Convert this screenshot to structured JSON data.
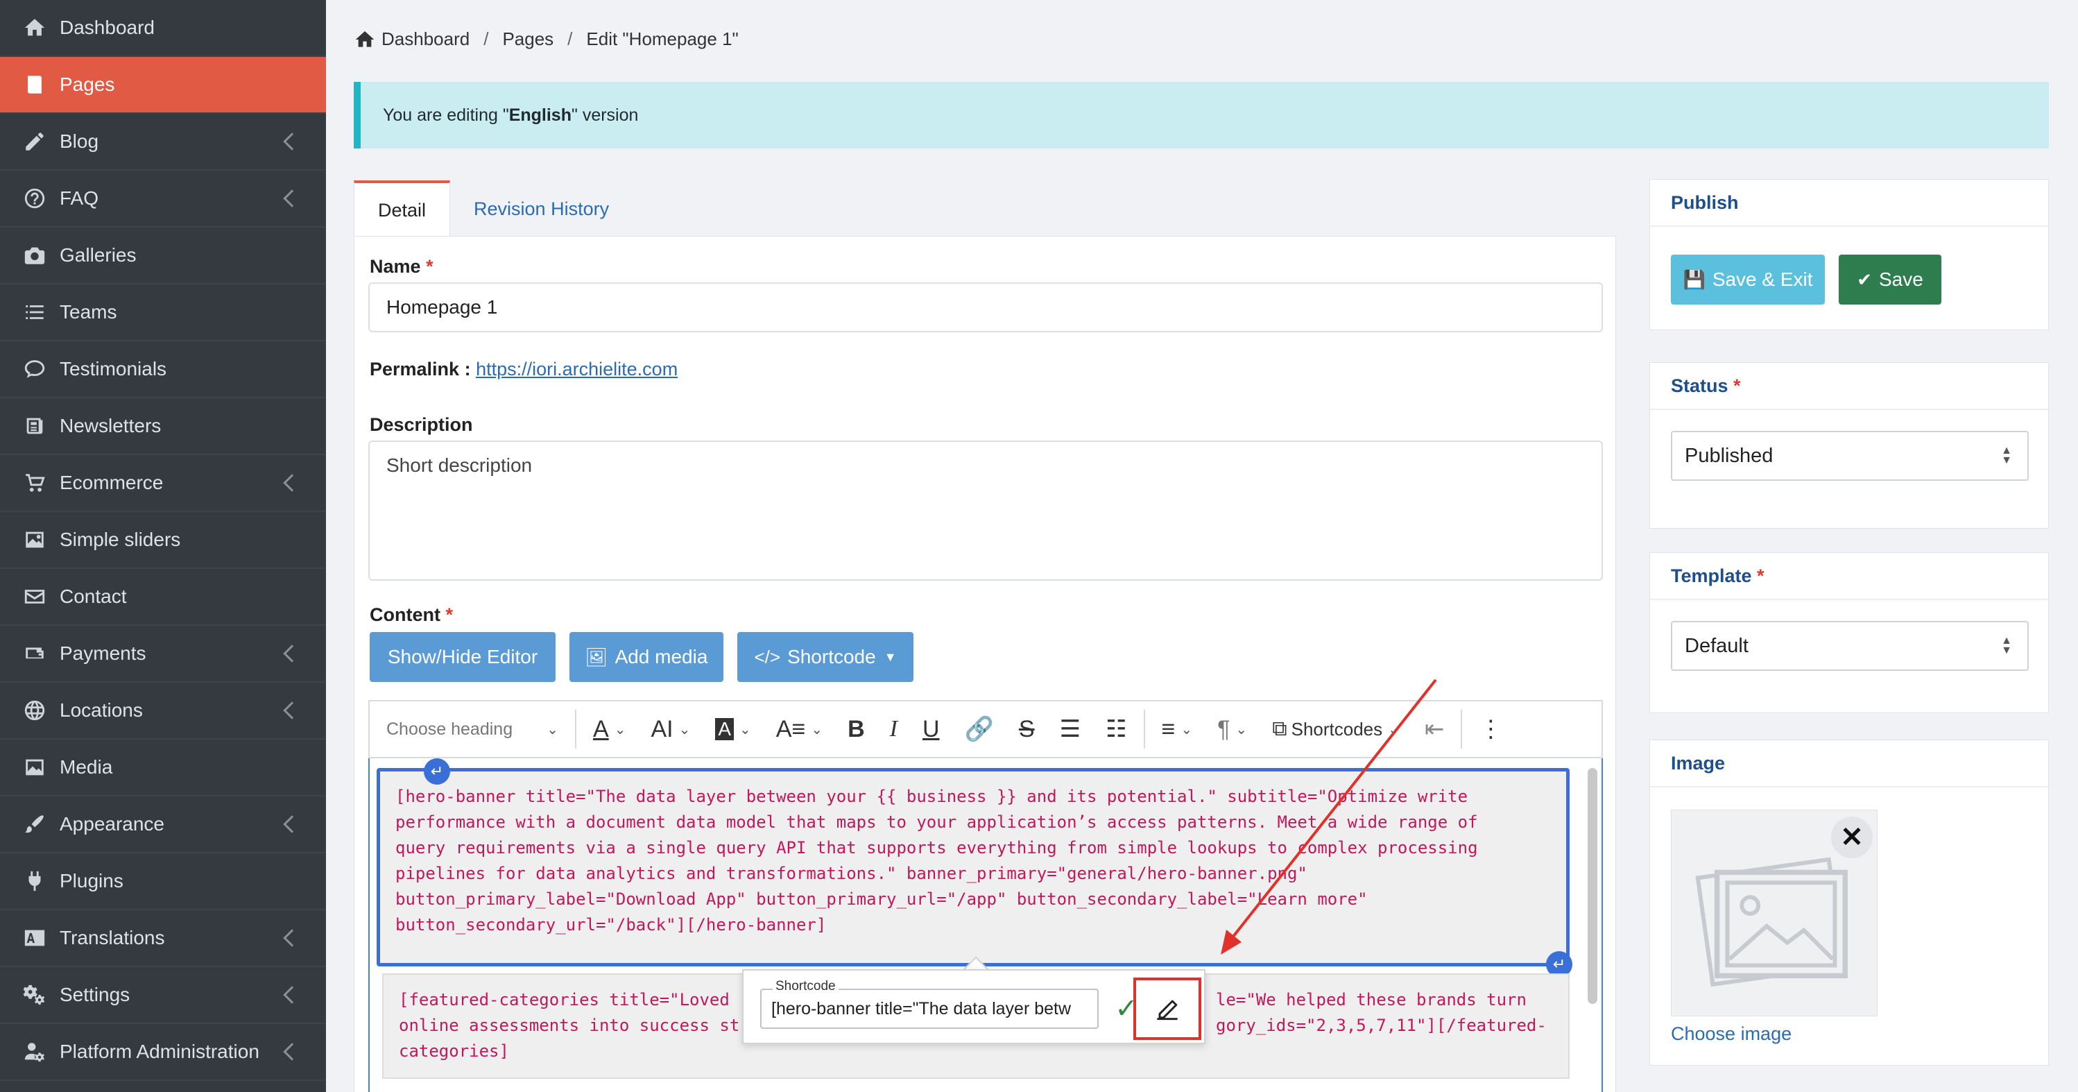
{
  "sidebar": {
    "items": [
      {
        "label": "Dashboard",
        "icon": "home-icon",
        "active": false,
        "has_children": false
      },
      {
        "label": "Pages",
        "icon": "book-icon",
        "active": true,
        "has_children": false
      },
      {
        "label": "Blog",
        "icon": "pencil-icon",
        "active": false,
        "has_children": true
      },
      {
        "label": "FAQ",
        "icon": "question-icon",
        "active": false,
        "has_children": true
      },
      {
        "label": "Galleries",
        "icon": "camera-icon",
        "active": false,
        "has_children": false
      },
      {
        "label": "Teams",
        "icon": "list-icon",
        "active": false,
        "has_children": false
      },
      {
        "label": "Testimonials",
        "icon": "comment-icon",
        "active": false,
        "has_children": false
      },
      {
        "label": "Newsletters",
        "icon": "newspaper-icon",
        "active": false,
        "has_children": false
      },
      {
        "label": "Ecommerce",
        "icon": "cart-icon",
        "active": false,
        "has_children": true
      },
      {
        "label": "Simple sliders",
        "icon": "image-icon",
        "active": false,
        "has_children": false
      },
      {
        "label": "Contact",
        "icon": "envelope-icon",
        "active": false,
        "has_children": false
      },
      {
        "label": "Payments",
        "icon": "wallet-icon",
        "active": false,
        "has_children": true
      },
      {
        "label": "Locations",
        "icon": "globe-icon",
        "active": false,
        "has_children": true
      },
      {
        "label": "Media",
        "icon": "media-icon",
        "active": false,
        "has_children": false
      },
      {
        "label": "Appearance",
        "icon": "brush-icon",
        "active": false,
        "has_children": true
      },
      {
        "label": "Plugins",
        "icon": "plug-icon",
        "active": false,
        "has_children": false
      },
      {
        "label": "Translations",
        "icon": "language-icon",
        "active": false,
        "has_children": true
      },
      {
        "label": "Settings",
        "icon": "gears-icon",
        "active": false,
        "has_children": true
      },
      {
        "label": "Platform Administration",
        "icon": "user-gear-icon",
        "active": false,
        "has_children": true
      }
    ]
  },
  "breadcrumb": {
    "items": [
      "Dashboard",
      "Pages",
      "Edit \"Homepage 1\""
    ],
    "separator": "/"
  },
  "alert": {
    "prefix": "You are editing \"",
    "language": "English",
    "suffix": "\" version"
  },
  "tabs": [
    {
      "label": "Detail",
      "active": true
    },
    {
      "label": "Revision History",
      "active": false
    }
  ],
  "form": {
    "name_label": "Name",
    "required_mark": "*",
    "name_value": "Homepage 1",
    "permalink_label": "Permalink :",
    "permalink_url": "https://iori.archielite.com",
    "description_label": "Description",
    "description_placeholder": "Short description",
    "content_label": "Content",
    "buttons": {
      "show_hide": "Show/Hide Editor",
      "add_media": "Add media",
      "shortcode": "Shortcode"
    }
  },
  "toolbar": {
    "heading_placeholder": "Choose heading",
    "shortcodes_label": "Shortcodes"
  },
  "editor": {
    "block1": "[hero-banner title=\"The data layer between your {{ business }} and its potential.\" subtitle=\"Optimize write\nperformance with a document data model that maps to your application’s access patterns. Meet a wide range of\nquery requirements via a single query API that supports everything from simple lookups to complex processing\npipelines for data analytics and transformations.\" banner_primary=\"general/hero-banner.png\"\nbutton_primary_label=\"Download App\" button_primary_url=\"/app\" button_secondary_label=\"Learn more\"\nbutton_secondary_url=\"/back\"][/hero-banner]",
    "block2_left": "[featured-categories title=\"Loved\nonline assessments into success st\ncategories]",
    "block2_right": "le=\"We helped these brands turn\ngory_ids=\"2,3,5,7,11\"][/featured-"
  },
  "popup": {
    "label": "Shortcode",
    "value": "[hero-banner title=\"The data layer betw"
  },
  "publish": {
    "title": "Publish",
    "save_exit_label": "Save & Exit",
    "save_label": "Save"
  },
  "status": {
    "title": "Status",
    "value": "Published"
  },
  "template": {
    "title": "Template",
    "value": "Default"
  },
  "image": {
    "title": "Image",
    "choose_label": "Choose image"
  },
  "colors": {
    "sidebar_bg": "#343a40",
    "active_item": "#e05a44",
    "primary_blue": "#5a9bd5",
    "save_green": "#2e7d4f",
    "annotation_red": "#e0322a"
  }
}
